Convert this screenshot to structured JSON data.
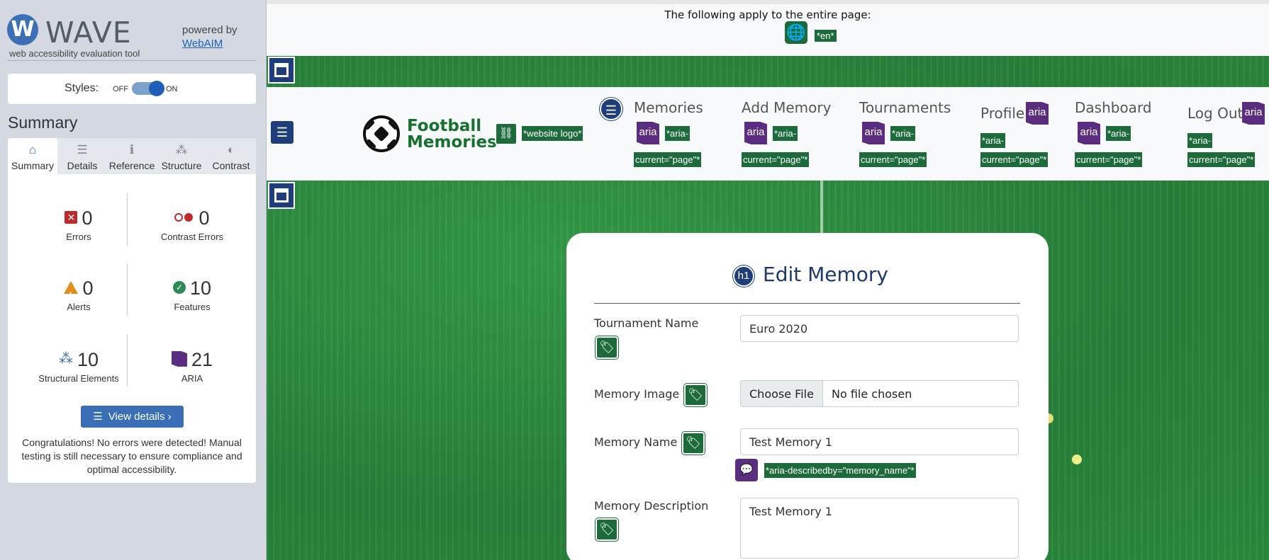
{
  "wave": {
    "logo_mark": "W",
    "logo_text": "WAVE",
    "tagline": "web accessibility evaluation tool",
    "powered_by": "powered by",
    "powered_link": "WebAIM",
    "styles_label": "Styles:",
    "toggle_off": "OFF",
    "toggle_on": "ON",
    "summary_heading": "Summary",
    "tabs": [
      {
        "label": "Summary",
        "icon": "home-icon",
        "glyph": "⌂"
      },
      {
        "label": "Details",
        "icon": "list-icon",
        "glyph": "☰"
      },
      {
        "label": "Reference",
        "icon": "info-icon",
        "glyph": "ℹ"
      },
      {
        "label": "Structure",
        "icon": "hierarchy-icon",
        "glyph": "⁂"
      },
      {
        "label": "Contrast",
        "icon": "contrast-icon",
        "glyph": "◐"
      }
    ],
    "stats": {
      "errors": {
        "count": "0",
        "label": "Errors"
      },
      "contrast_errors": {
        "count": "0",
        "label": "Contrast Errors"
      },
      "alerts": {
        "count": "0",
        "label": "Alerts"
      },
      "features": {
        "count": "10",
        "label": "Features"
      },
      "structural": {
        "count": "10",
        "label": "Structural Elements"
      },
      "aria": {
        "count": "21",
        "label": "ARIA"
      }
    },
    "view_details": "View details ›",
    "congrats": "Congratulations! No errors were detected! Manual testing is still necessary to ensure compliance and optimal accessibility.",
    "colors": {
      "accent": "#3b6fb6",
      "error": "#c0282e",
      "alert": "#e38d14",
      "feature": "#2e8b57",
      "aria": "#5a2d80"
    }
  },
  "page": {
    "top_notice": "The following apply to the entire page:",
    "lang_tag": "*en*",
    "brand_line1": "Football",
    "brand_line2": "Memories",
    "logo_tag": "*website logo*",
    "nav": [
      {
        "label": "Memories",
        "tag1": "*aria-",
        "tag2": "current=\"page\"*"
      },
      {
        "label": "Add Memory",
        "tag1": "*aria-",
        "tag2": "current=\"page\"*"
      },
      {
        "label": "Tournaments",
        "tag1": "*aria-",
        "tag2": "current=\"page\"*"
      },
      {
        "label": "Profile",
        "tag1": "*aria-",
        "tag2": "current=\"page\"*"
      },
      {
        "label": "Dashboard",
        "tag1": "*aria-",
        "tag2": "current=\"page\"*"
      },
      {
        "label": "Log Out",
        "tag1": "*aria-",
        "tag2": "current=\"page\"*"
      }
    ],
    "aria_icon_text": "aria",
    "h1_icon_text": "h1",
    "form": {
      "title": "Edit Memory",
      "tournament_label": "Tournament Name",
      "tournament_value": "Euro 2020",
      "image_label": "Memory Image",
      "file_button": "Choose File",
      "file_status": "No file chosen",
      "name_label": "Memory Name",
      "name_value": "Test Memory 1",
      "name_describedby_tag": "*aria-describedby=\"memory_name\"*",
      "description_label": "Memory Description",
      "description_value": "Test Memory 1"
    }
  }
}
